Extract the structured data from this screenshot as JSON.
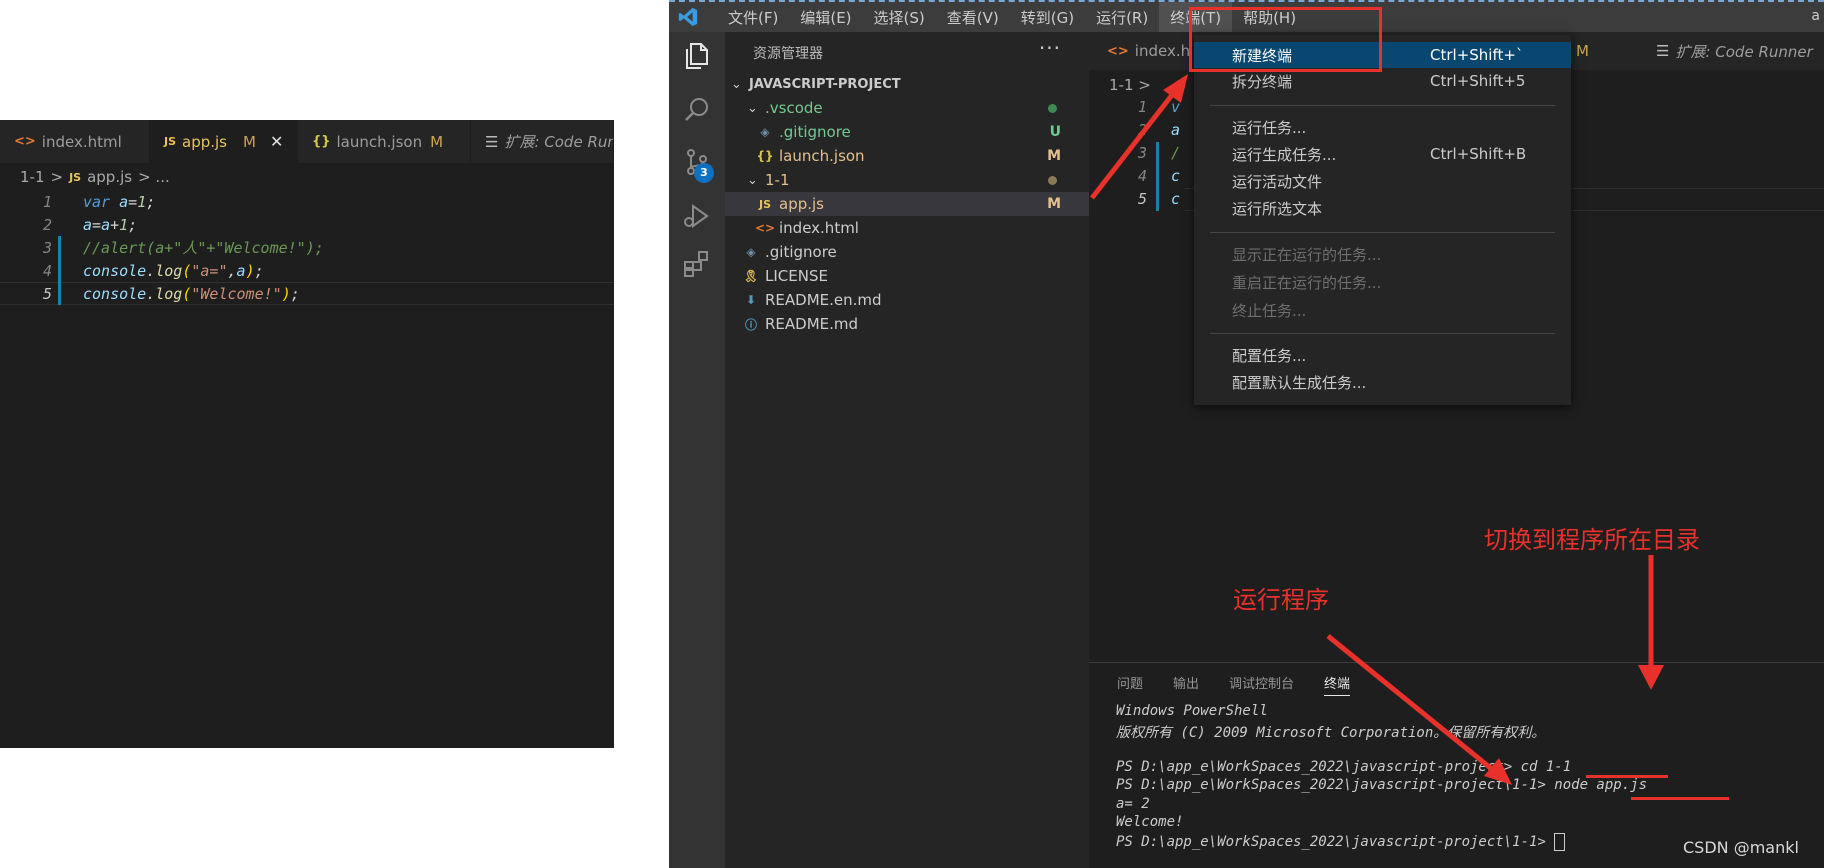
{
  "left_editor": {
    "tabs": [
      {
        "icon": "html-icon",
        "label": "index.html",
        "modified": "",
        "close": ""
      },
      {
        "icon": "js-icon",
        "label": "app.js",
        "modified": "M",
        "close": "✕"
      },
      {
        "icon": "json-icon",
        "label": "launch.json",
        "modified": "M",
        "close": ""
      },
      {
        "icon": "extension-icon",
        "label": "扩展: Code Runn",
        "modified": "",
        "close": ""
      }
    ],
    "breadcrumb": {
      "folder": "1-1",
      "sep": ">",
      "file": "app.js",
      "tail": "> ..."
    },
    "lines": [
      {
        "n": "1",
        "code": "var a=1;"
      },
      {
        "n": "2",
        "code": "a=a+1;"
      },
      {
        "n": "3",
        "code": "//alert(a+\"人\"+\"Welcome!\");"
      },
      {
        "n": "4",
        "code": "console.log(\"a=\",a);"
      },
      {
        "n": "5",
        "code": "console.log(\"Welcome!\");"
      }
    ]
  },
  "window": {
    "menus": [
      "文件(F)",
      "编辑(E)",
      "选择(S)",
      "查看(V)",
      "转到(G)",
      "运行(R)",
      "终端(T)",
      "帮助(H)"
    ],
    "active_menu": "终端(T)",
    "account_initial": "a",
    "scm_badge": "3",
    "explorer": {
      "header": "资源管理器",
      "more": "···",
      "items": [
        {
          "label": "JAVASCRIPT-PROJECT",
          "type": "root",
          "status": ""
        },
        {
          "label": ".vscode",
          "type": "folder",
          "status": "dot"
        },
        {
          "label": ".gitignore",
          "type": "gitignore",
          "status": "U"
        },
        {
          "label": "launch.json",
          "type": "json",
          "status": "M"
        },
        {
          "label": "1-1",
          "type": "folder",
          "status": "dot"
        },
        {
          "label": "app.js",
          "type": "js",
          "status": "M"
        },
        {
          "label": "index.html",
          "type": "html",
          "status": ""
        },
        {
          "label": ".gitignore",
          "type": "gitignore",
          "status": ""
        },
        {
          "label": "LICENSE",
          "type": "license",
          "status": ""
        },
        {
          "label": "README.en.md",
          "type": "md",
          "status": ""
        },
        {
          "label": "README.md",
          "type": "info",
          "status": ""
        }
      ]
    },
    "editor": {
      "tabs": [
        {
          "label": "index.h"
        },
        {
          "label": "M"
        },
        {
          "label": "扩展: Code Runner"
        }
      ],
      "breadcrumb": "1-1 >",
      "line_numbers": [
        "1",
        "2",
        "3",
        "4",
        "5"
      ],
      "line_stubs": [
        "v",
        "a",
        "/",
        "c",
        "c"
      ]
    },
    "terminal_menu": [
      {
        "label": "新建终端",
        "shortcut": "Ctrl+Shift+`",
        "state": "highlight"
      },
      {
        "label": "拆分终端",
        "shortcut": "Ctrl+Shift+5",
        "state": "normal"
      },
      {
        "label": "运行任务...",
        "shortcut": "",
        "state": "normal"
      },
      {
        "label": "运行生成任务...",
        "shortcut": "Ctrl+Shift+B",
        "state": "normal"
      },
      {
        "label": "运行活动文件",
        "shortcut": "",
        "state": "normal"
      },
      {
        "label": "运行所选文本",
        "shortcut": "",
        "state": "normal"
      },
      {
        "label": "显示正在运行的任务...",
        "shortcut": "",
        "state": "disabled"
      },
      {
        "label": "重启正在运行的任务...",
        "shortcut": "",
        "state": "disabled"
      },
      {
        "label": "终止任务...",
        "shortcut": "",
        "state": "disabled"
      },
      {
        "label": "配置任务...",
        "shortcut": "",
        "state": "normal"
      },
      {
        "label": "配置默认生成任务...",
        "shortcut": "",
        "state": "normal"
      }
    ],
    "panel": {
      "tabs": [
        "问题",
        "输出",
        "调试控制台",
        "终端"
      ],
      "active_tab": "终端",
      "terminal_lines": [
        "Windows PowerShell",
        "版权所有 (C) 2009 Microsoft Corporation。保留所有权利。",
        "",
        "PS D:\\app_e\\WorkSpaces_2022\\javascript-project> cd 1-1",
        "PS D:\\app_e\\WorkSpaces_2022\\javascript-project\\1-1> node app.js",
        "a= 2",
        "Welcome!",
        "PS D:\\app_e\\WorkSpaces_2022\\javascript-project\\1-1> "
      ]
    }
  },
  "annotations": {
    "switch_dir": "切换到程序所在目录",
    "run_program": "运行程序",
    "color": "#e8312b"
  },
  "watermark": "CSDN @mankl"
}
